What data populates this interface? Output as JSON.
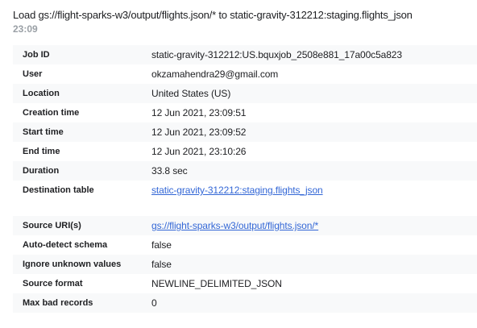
{
  "header": {
    "title": "Load gs://flight-sparks-w3/output/flights.json/* to static-gravity-312212:staging.flights_json",
    "time": "23:09"
  },
  "job_details": [
    {
      "label": "Job ID",
      "value": "static-gravity-312212:US.bquxjob_2508e881_17a00c5a823"
    },
    {
      "label": "User",
      "value": "okzamahendra29@gmail.com"
    },
    {
      "label": "Location",
      "value": "United States (US)"
    },
    {
      "label": "Creation time",
      "value": "12 Jun 2021, 23:09:51"
    },
    {
      "label": "Start time",
      "value": "12 Jun 2021, 23:09:52"
    },
    {
      "label": "End time",
      "value": "12 Jun 2021, 23:10:26"
    },
    {
      "label": "Duration",
      "value": "33.8 sec"
    },
    {
      "label": "Destination table",
      "value": "static-gravity-312212:staging.flights_json"
    }
  ],
  "load_details": [
    {
      "label": "Source URI(s)",
      "value": "gs://flight-sparks-w3/output/flights.json/*"
    },
    {
      "label": "Auto-detect schema",
      "value": "false"
    },
    {
      "label": "Ignore unknown values",
      "value": "false"
    },
    {
      "label": "Source format",
      "value": "NEWLINE_DELIMITED_JSON"
    },
    {
      "label": "Max bad records",
      "value": "0"
    }
  ]
}
